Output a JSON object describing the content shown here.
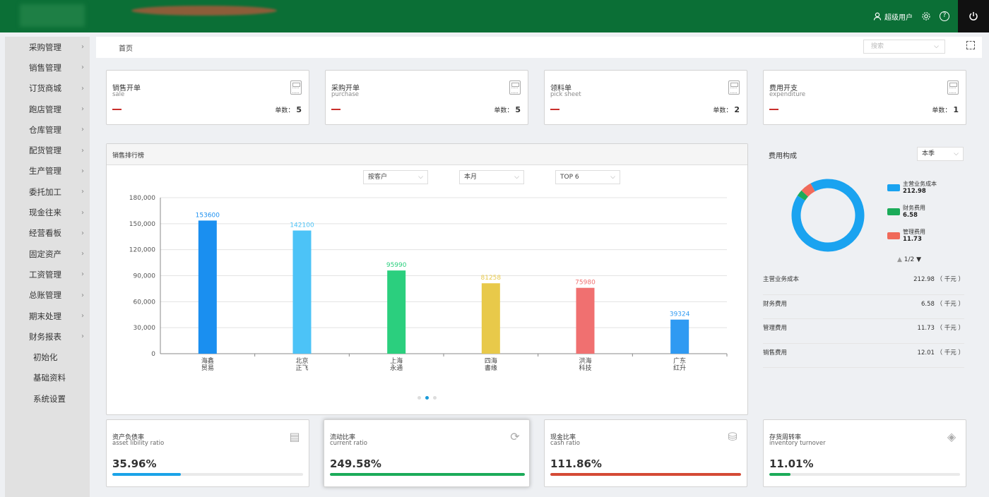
{
  "header": {
    "user_name": "超级用户",
    "icons": [
      "user-icon",
      "gear-icon",
      "help-icon",
      "power-icon"
    ]
  },
  "sidebar": {
    "items": [
      {
        "label": "采购管理",
        "arrow": true
      },
      {
        "label": "销售管理",
        "arrow": true
      },
      {
        "label": "订货商城",
        "arrow": true
      },
      {
        "label": "跑店管理",
        "arrow": true
      },
      {
        "label": "仓库管理",
        "arrow": true
      },
      {
        "label": "配货管理",
        "arrow": true
      },
      {
        "label": "生产管理",
        "arrow": true
      },
      {
        "label": "委托加工",
        "arrow": true
      },
      {
        "label": "现金往来",
        "arrow": true
      },
      {
        "label": "经营看板",
        "arrow": true
      },
      {
        "label": "固定资产",
        "arrow": true
      },
      {
        "label": "工资管理",
        "arrow": true
      },
      {
        "label": "总账管理",
        "arrow": true
      },
      {
        "label": "期末处理",
        "arrow": true
      },
      {
        "label": "财务报表",
        "arrow": true
      },
      {
        "label": "初始化",
        "arrow": false
      },
      {
        "label": "基础资料",
        "arrow": false
      },
      {
        "label": "系统设置",
        "arrow": false
      }
    ]
  },
  "breadcrumb": {
    "home": "首页"
  },
  "search": {
    "placeholder": "搜索"
  },
  "stat_cards": [
    {
      "title": "销售开单",
      "subtitle": "sale",
      "count_label": "单数：",
      "count": "5"
    },
    {
      "title": "采购开单",
      "subtitle": "purchase",
      "count_label": "单数：",
      "count": "5"
    },
    {
      "title": "领料单",
      "subtitle": "pick sheet",
      "count_label": "单数：",
      "count": "2"
    },
    {
      "title": "费用开支",
      "subtitle": "expenditure",
      "count_label": "单数：",
      "count": "1"
    }
  ],
  "sales_rank": {
    "panel_title": "销售排行榜",
    "filters": [
      "按客户",
      "本月",
      "TOP 6"
    ]
  },
  "chart_data": {
    "type": "bar",
    "categories": [
      "海鑫\n贸易",
      "北京\n正飞",
      "上海\n永通",
      "四海\n書缘",
      "洪海\n科技",
      "广东\n红升"
    ],
    "values": [
      153600,
      142100,
      95990,
      81258,
      75980,
      39324
    ],
    "value_labels": [
      "153600",
      "142100",
      "95990",
      "81258",
      "75980",
      "39324"
    ],
    "bar_colors": [
      "#1a8ff0",
      "#4cc3f7",
      "#2bcf7e",
      "#e8c94a",
      "#f07070",
      "#2f9af2"
    ],
    "yticks": [
      "180,000",
      "150,000",
      "120,000",
      "90,000",
      "60,000",
      "30,000",
      "0"
    ],
    "ylim": [
      0,
      180000
    ],
    "grid": true,
    "pager_dots": 3,
    "active_dot": 1
  },
  "cost": {
    "title": "费用构成",
    "period": "本季",
    "pager": "1/2",
    "legend": [
      {
        "name": "主营业务成本",
        "value": "212.98",
        "color": "#1aa3f0"
      },
      {
        "name": "财务费用",
        "value": "6.58",
        "color": "#1bab59"
      },
      {
        "name": "管理费用",
        "value": "11.73",
        "color": "#f06a5a"
      }
    ],
    "rows": [
      {
        "label": "主营业务成本",
        "value": "212.98 （ 千元 ）"
      },
      {
        "label": "财务费用",
        "value": "6.58 （ 千元 ）"
      },
      {
        "label": "管理费用",
        "value": "11.73 （ 千元 ）"
      },
      {
        "label": "销售费用",
        "value": "12.01 （ 千元 ）"
      }
    ]
  },
  "ratios": [
    {
      "title": "资产负债率",
      "subtitle": "asset libility ratio",
      "value": "35.96%",
      "progress": 0.36,
      "color": "#1aa3e8",
      "icon": "report-icon"
    },
    {
      "title": "流动比率",
      "subtitle": "current ratio",
      "value": "249.58%",
      "progress": 1.0,
      "color": "#1bab59",
      "icon": "exchange-icon"
    },
    {
      "title": "现金比率",
      "subtitle": "cash ratio",
      "value": "111.86%",
      "progress": 1.0,
      "color": "#d44a35",
      "icon": "coins-icon"
    },
    {
      "title": "存货周转率",
      "subtitle": "inventory turnover",
      "value": "11.01%",
      "progress": 0.11,
      "color": "#1bab59",
      "icon": "box-icon"
    }
  ]
}
